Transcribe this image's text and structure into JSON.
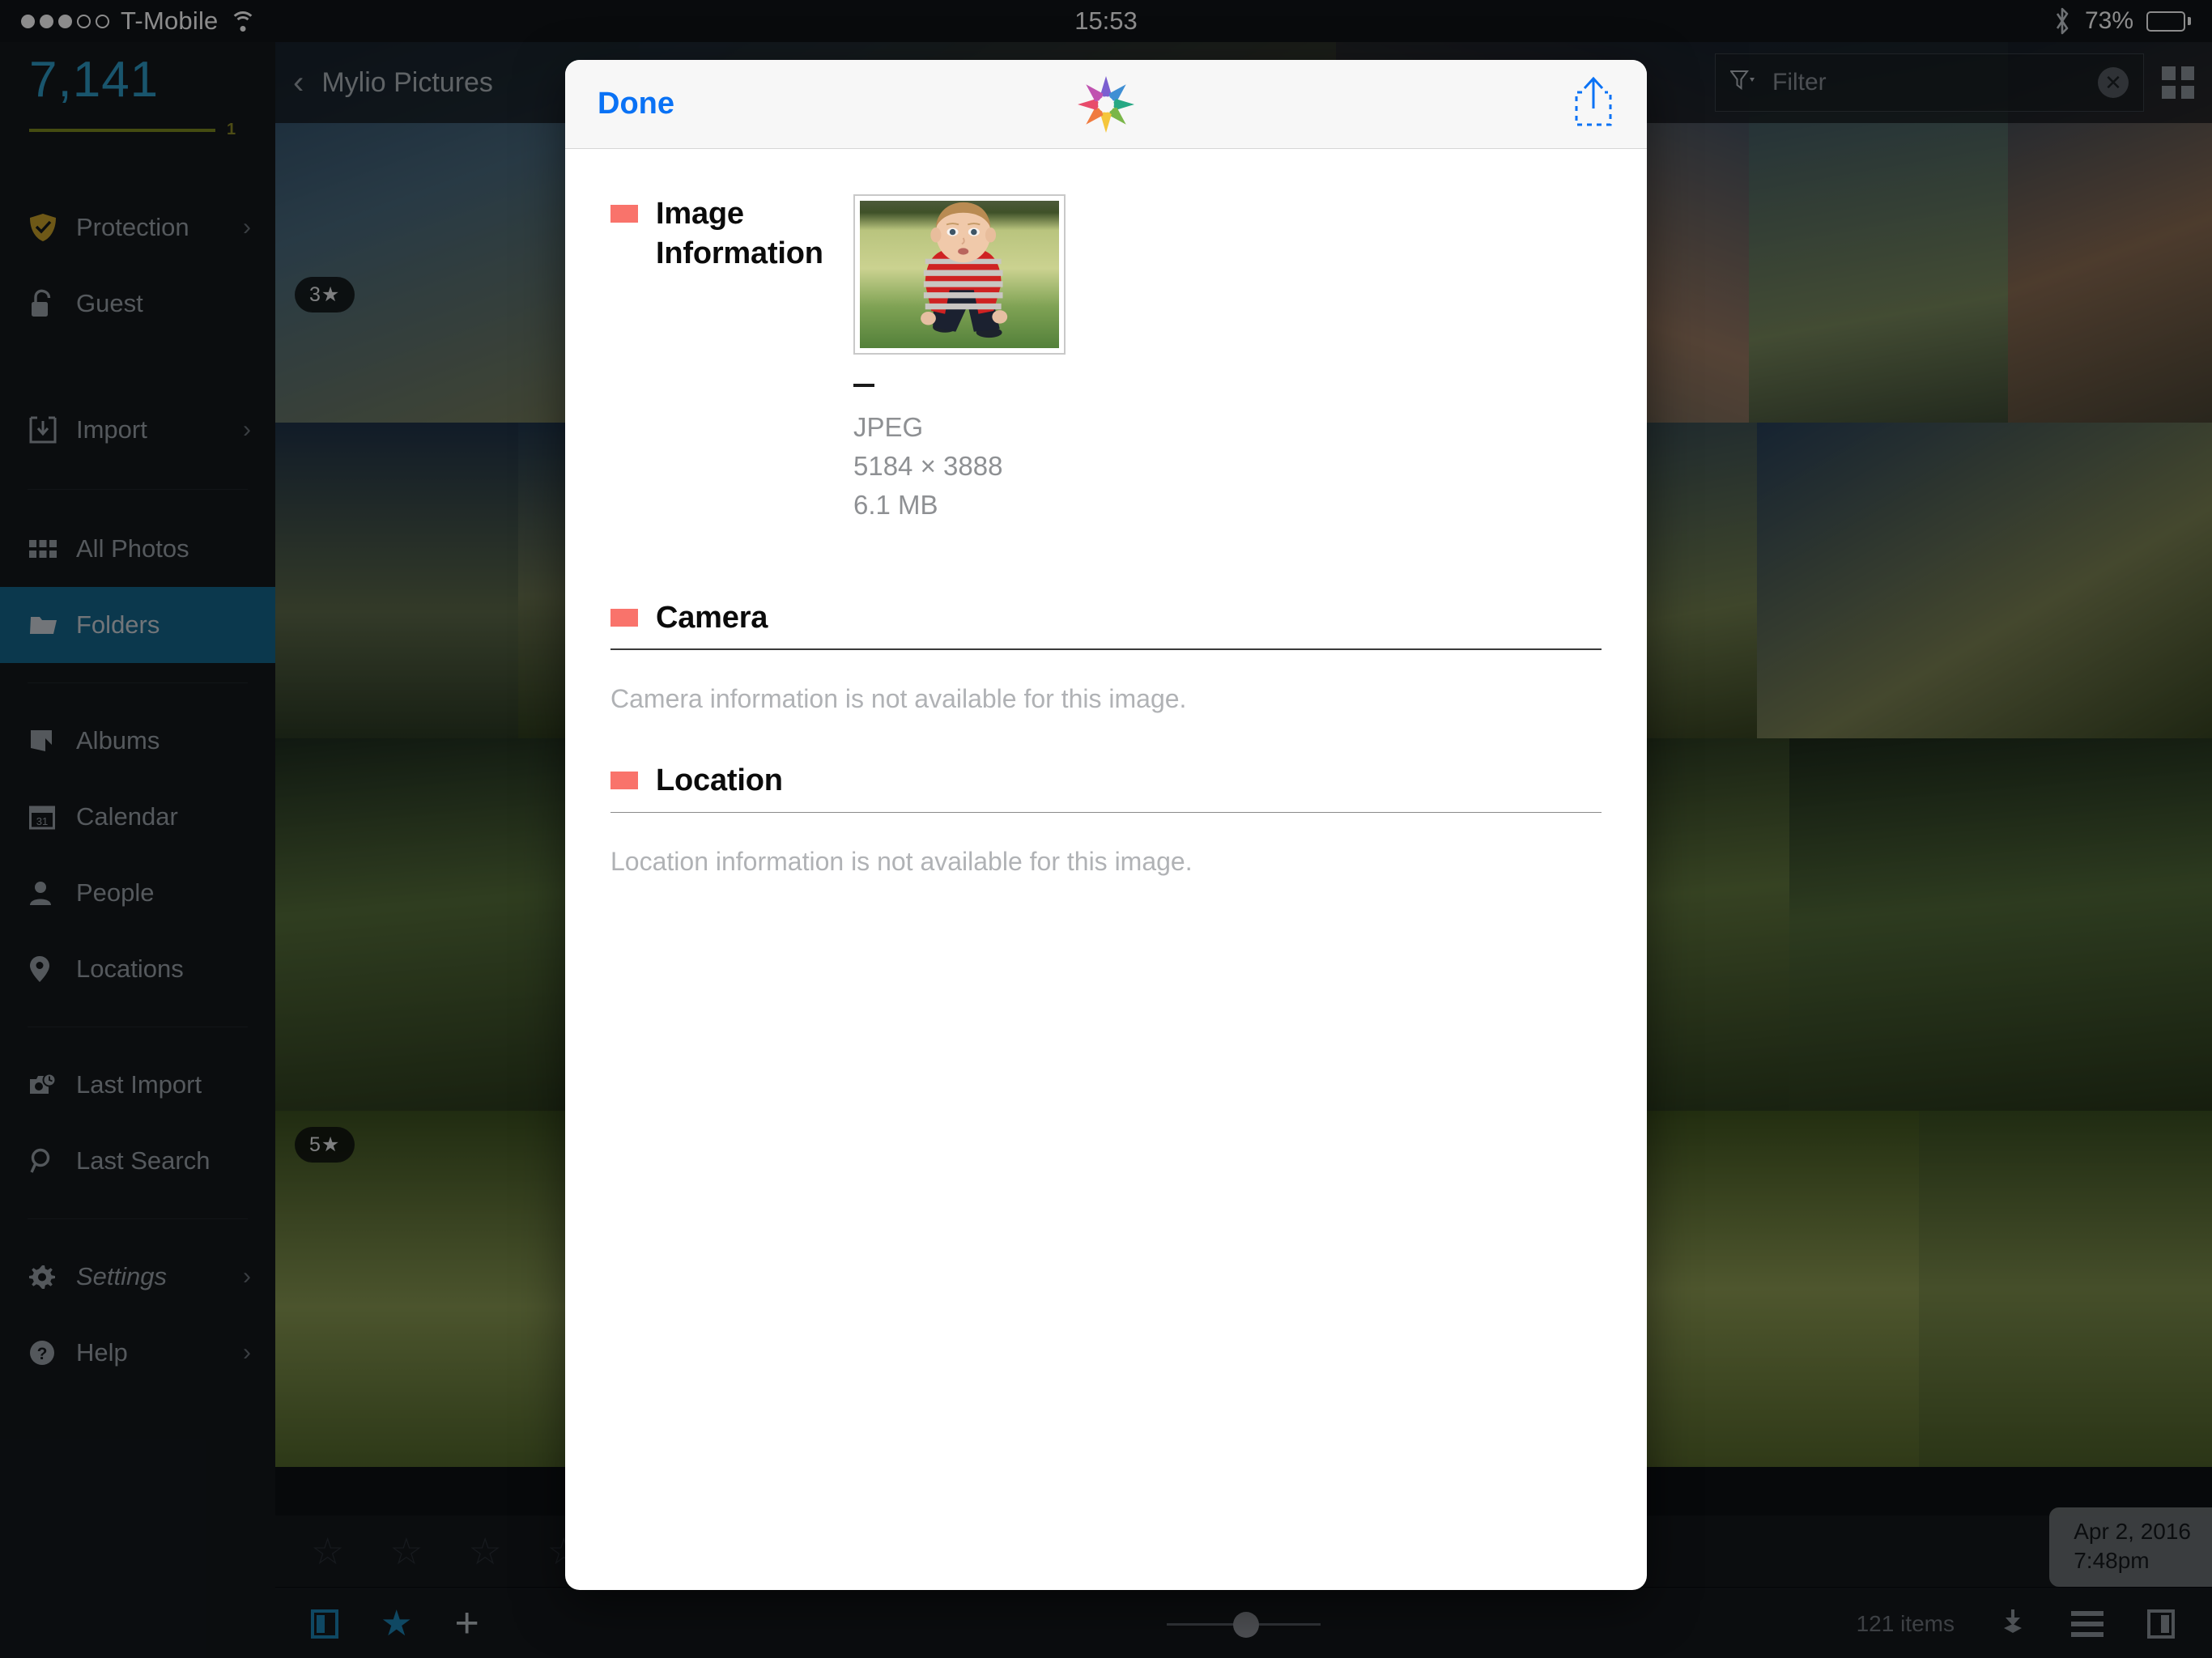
{
  "statusbar": {
    "carrier": "T-Mobile",
    "signal_dots_filled": 3,
    "signal_dots_total": 5,
    "wifi_icon": "wifi-icon",
    "time": "15:53",
    "bluetooth_icon": "bluetooth-icon",
    "battery_percent": "73%",
    "battery_level": 73
  },
  "sidebar": {
    "photo_count": "7,141",
    "progress_label": "1",
    "progress_color": "#7e8b1f",
    "count_color": "#2e9bc7",
    "groups": [
      {
        "items": [
          {
            "label": "Protection",
            "icon": "shield-check-icon",
            "chevron": "›",
            "dim": true
          },
          {
            "label": "Guest",
            "icon": "unlock-icon",
            "chevron": ""
          }
        ]
      },
      {
        "items": [
          {
            "label": "Import",
            "icon": "import-icon",
            "chevron": "›",
            "dim": true
          }
        ]
      },
      {
        "items": [
          {
            "label": "All Photos",
            "icon": "grid-icon",
            "chevron": ""
          },
          {
            "label": "Folders",
            "icon": "folder-icon",
            "chevron": "",
            "active": true
          }
        ]
      },
      {
        "items": [
          {
            "label": "Albums",
            "icon": "album-icon",
            "chevron": ""
          },
          {
            "label": "Calendar",
            "icon": "calendar-icon",
            "chevron": ""
          },
          {
            "label": "People",
            "icon": "person-icon",
            "chevron": ""
          },
          {
            "label": "Locations",
            "icon": "pin-icon",
            "chevron": ""
          }
        ]
      },
      {
        "items": [
          {
            "label": "Last Import",
            "icon": "camera-clock-icon",
            "chevron": ""
          },
          {
            "label": "Last Search",
            "icon": "search-icon",
            "chevron": ""
          }
        ]
      },
      {
        "items": [
          {
            "label": "Settings",
            "icon": "gear-icon",
            "chevron": "›",
            "italic": true
          },
          {
            "label": "Help",
            "icon": "help-icon",
            "chevron": "›"
          }
        ]
      }
    ],
    "active_color": "#14678c"
  },
  "topbar": {
    "back_glyph": "‹",
    "breadcrumb": "Mylio Pictures",
    "filter_icon": "filter-icon",
    "filter_placeholder": "Filter",
    "filter_value": "",
    "clear_glyph": "✕",
    "grid_toggle_icon": "grid-view-icon"
  },
  "grid": {
    "badges": [
      {
        "label": "3★"
      },
      {
        "label": "5★"
      }
    ],
    "date_badge": {
      "date": "Apr 2, 2016",
      "time": "7:48pm"
    },
    "rating_stars": [
      "☆",
      "☆",
      "☆",
      "☆",
      "☆"
    ]
  },
  "bottombar": {
    "panel_icon": "left-panel-icon",
    "star_icon": "star-icon",
    "plus_icon": "plus-icon",
    "zoom_slider_value": 50,
    "item_count": "121 items",
    "download_icon": "download-icon",
    "list_icon": "list-icon",
    "right_panel_icon": "right-panel-icon"
  },
  "modal": {
    "done_label": "Done",
    "logo_icon": "mylio-star-logo",
    "share_icon": "share-icon",
    "sections": [
      {
        "id": "image-information",
        "title": "Image Information",
        "chip_color": "#f9736b",
        "thumbnail_alt": "toddler in red striped sweater crouching on grass",
        "dash": "—",
        "meta": [
          "JPEG",
          "5184 × 3888",
          "6.1 MB"
        ]
      },
      {
        "id": "camera",
        "title": "Camera",
        "chip_color": "#f9736b",
        "body": "Camera information is not available for this image."
      },
      {
        "id": "location",
        "title": "Location",
        "chip_color": "#f9736b",
        "body": "Location information is not available for this image."
      }
    ]
  }
}
